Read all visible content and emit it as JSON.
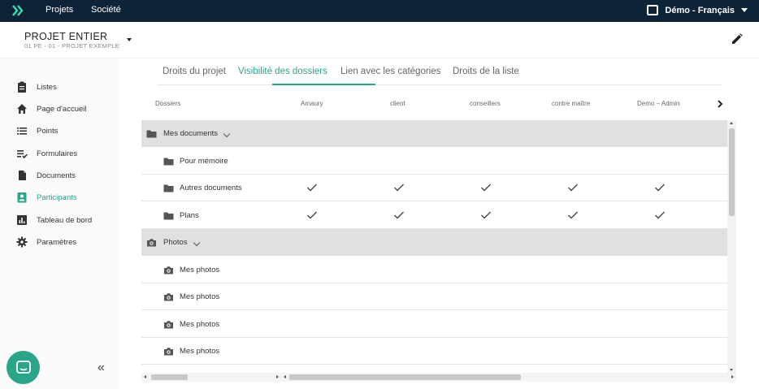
{
  "topnav": {
    "links": [
      "Projets",
      "Société"
    ],
    "user_label": "Démo - Français"
  },
  "project": {
    "title": "PROJET ENTIER",
    "subtitle": "01 PE - 01 - PROJET EXEMPLE"
  },
  "sidebar": {
    "items": [
      {
        "label": "Listes",
        "icon": "clipboard-icon"
      },
      {
        "label": "Page d'accueil",
        "icon": "home-icon"
      },
      {
        "label": "Points",
        "icon": "list-icon"
      },
      {
        "label": "Formulaires",
        "icon": "checklist-icon"
      },
      {
        "label": "Documents",
        "icon": "document-icon"
      },
      {
        "label": "Participants",
        "icon": "contact-card-icon",
        "active": true
      },
      {
        "label": "Tableau de bord",
        "icon": "bar-chart-icon"
      },
      {
        "label": "Paramètres",
        "icon": "gear-icon"
      }
    ],
    "collapse_glyph": "«"
  },
  "tabs": [
    {
      "label": "Droits du projet"
    },
    {
      "label": "Visibilité des dossiers",
      "active": true
    },
    {
      "label": "Lien avec les catégories"
    },
    {
      "label": "Droits de la liste"
    }
  ],
  "table": {
    "columns": [
      "Dossiers",
      "Amaury",
      "client",
      "conseillers",
      "contre maître",
      "Demo – Admin"
    ],
    "rows": [
      {
        "type": "group",
        "icon": "folder-icon",
        "label": "Mes documents",
        "checks": [
          false,
          false,
          false,
          false,
          false
        ]
      },
      {
        "type": "child",
        "icon": "folder-icon",
        "label": "Pour mémoire",
        "checks": [
          false,
          false,
          false,
          false,
          false
        ]
      },
      {
        "type": "child",
        "icon": "folder-icon",
        "label": "Autres documents",
        "checks": [
          true,
          true,
          true,
          true,
          true
        ]
      },
      {
        "type": "child",
        "icon": "folder-icon",
        "label": "Plans",
        "checks": [
          true,
          true,
          true,
          true,
          true
        ]
      },
      {
        "type": "group",
        "icon": "camera-icon",
        "label": "Photos",
        "checks": [
          false,
          false,
          false,
          false,
          false
        ]
      },
      {
        "type": "child",
        "icon": "camera-icon",
        "label": "Mes photos",
        "checks": [
          false,
          false,
          false,
          false,
          false
        ]
      },
      {
        "type": "child",
        "icon": "camera-icon",
        "label": "Mes photos",
        "checks": [
          false,
          false,
          false,
          false,
          false
        ]
      },
      {
        "type": "child",
        "icon": "camera-icon",
        "label": "Mes photos",
        "checks": [
          false,
          false,
          false,
          false,
          false
        ]
      },
      {
        "type": "child",
        "icon": "camera-icon",
        "label": "Mes photos",
        "checks": [
          false,
          false,
          false,
          false,
          false
        ]
      }
    ]
  },
  "colors": {
    "accent": "#2aa589",
    "topbar": "#0d2438",
    "group_row": "#e0e0e0"
  }
}
